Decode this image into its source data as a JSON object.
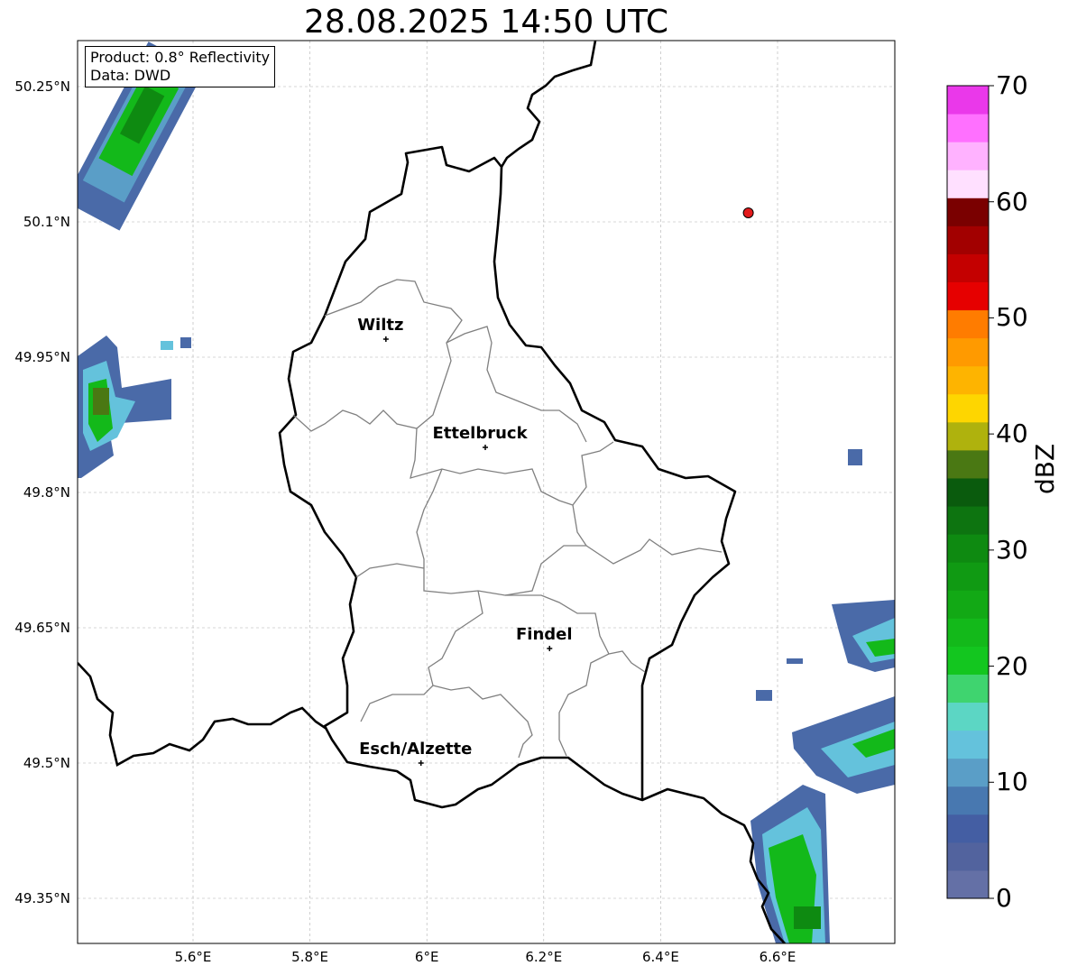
{
  "title": "28.08.2025 14:50 UTC",
  "info_box": {
    "product": "Product: 0.8° Reflectivity",
    "data": "Data: DWD"
  },
  "map": {
    "lon_ticks": [
      "5.6°E",
      "5.8°E",
      "6°E",
      "6.2°E",
      "6.4°E",
      "6.6°E"
    ],
    "lat_ticks": [
      "50.25°N",
      "50.1°N",
      "49.95°N",
      "49.8°N",
      "49.65°N",
      "49.5°N",
      "49.35°N"
    ],
    "cities": [
      {
        "name": "Wiltz",
        "lon": 5.93,
        "lat": 49.97
      },
      {
        "name": "Ettelbruck",
        "lon": 6.1,
        "lat": 49.85
      },
      {
        "name": "Findel",
        "lon": 6.21,
        "lat": 49.627
      },
      {
        "name": "Esch/Alzette",
        "lon": 5.99,
        "lat": 49.5
      }
    ],
    "radar_site_marker": {
      "lon": 6.55,
      "lat": 50.11,
      "color": "#e31a1c"
    }
  },
  "colorbar": {
    "unit": "dBZ",
    "ticks": [
      "0",
      "10",
      "20",
      "30",
      "40",
      "50",
      "60",
      "70"
    ],
    "colors": [
      "#6470a6",
      "#52639e",
      "#445ea3",
      "#4878b0",
      "#5a9ec7",
      "#64c2dc",
      "#5cd6c4",
      "#3fd46f",
      "#13c61f",
      "#13b91a",
      "#12a915",
      "#109a13",
      "#0e8a11",
      "#0d7410",
      "#0a5b0d",
      "#4a7813",
      "#afb20d",
      "#fed600",
      "#feb400",
      "#ff9a00",
      "#ff7c00",
      "#e60000",
      "#c40000",
      "#a20000",
      "#7a0000",
      "#ffe0ff",
      "#ffb2ff",
      "#ff70ff",
      "#ea38ea"
    ]
  }
}
